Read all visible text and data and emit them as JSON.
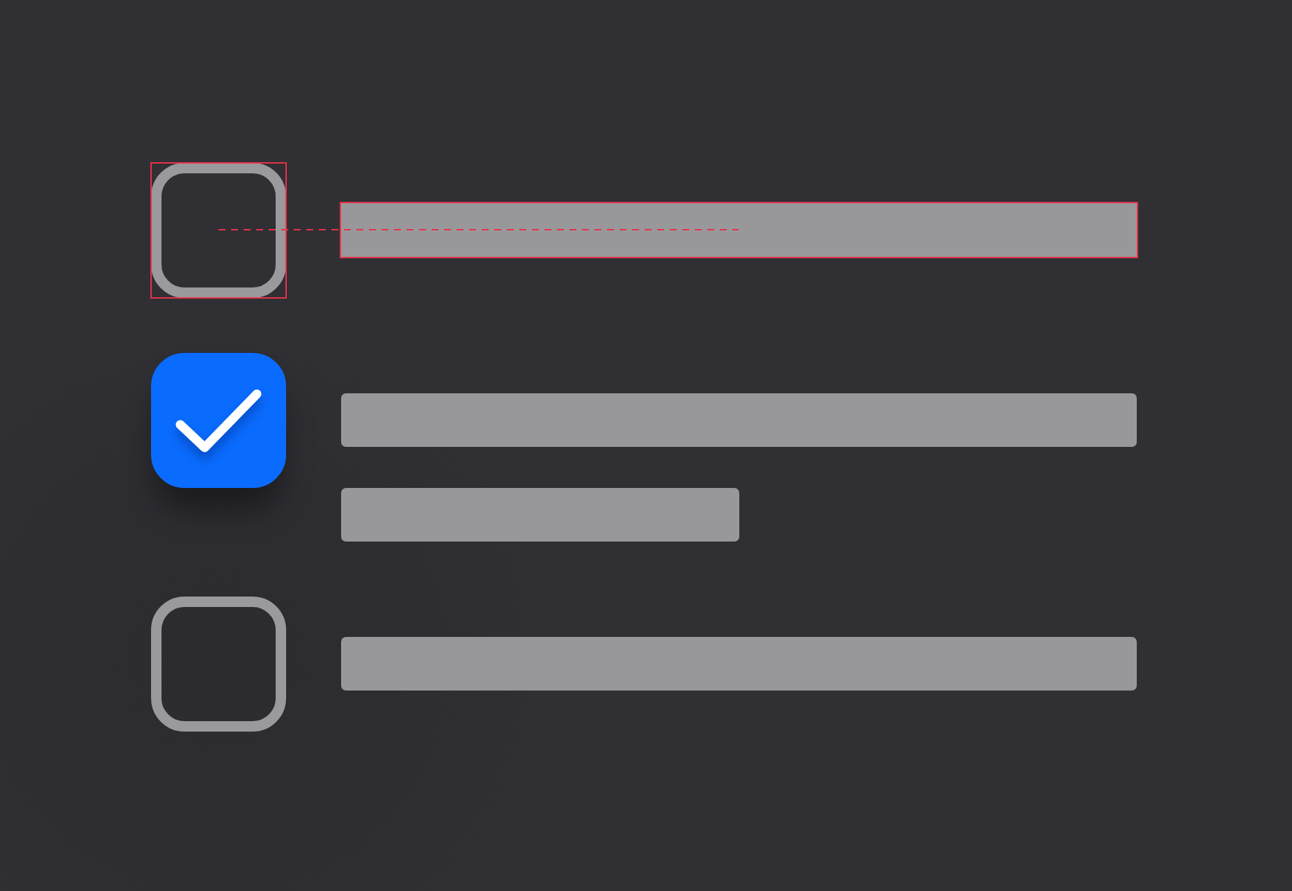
{
  "items": [
    {
      "checked": false,
      "annotated": true,
      "lines": [
        {
          "kind": "full"
        }
      ]
    },
    {
      "checked": true,
      "annotated": false,
      "lines": [
        {
          "kind": "full"
        },
        {
          "kind": "short"
        }
      ]
    },
    {
      "checked": false,
      "annotated": false,
      "lines": [
        {
          "kind": "full"
        }
      ]
    }
  ]
}
